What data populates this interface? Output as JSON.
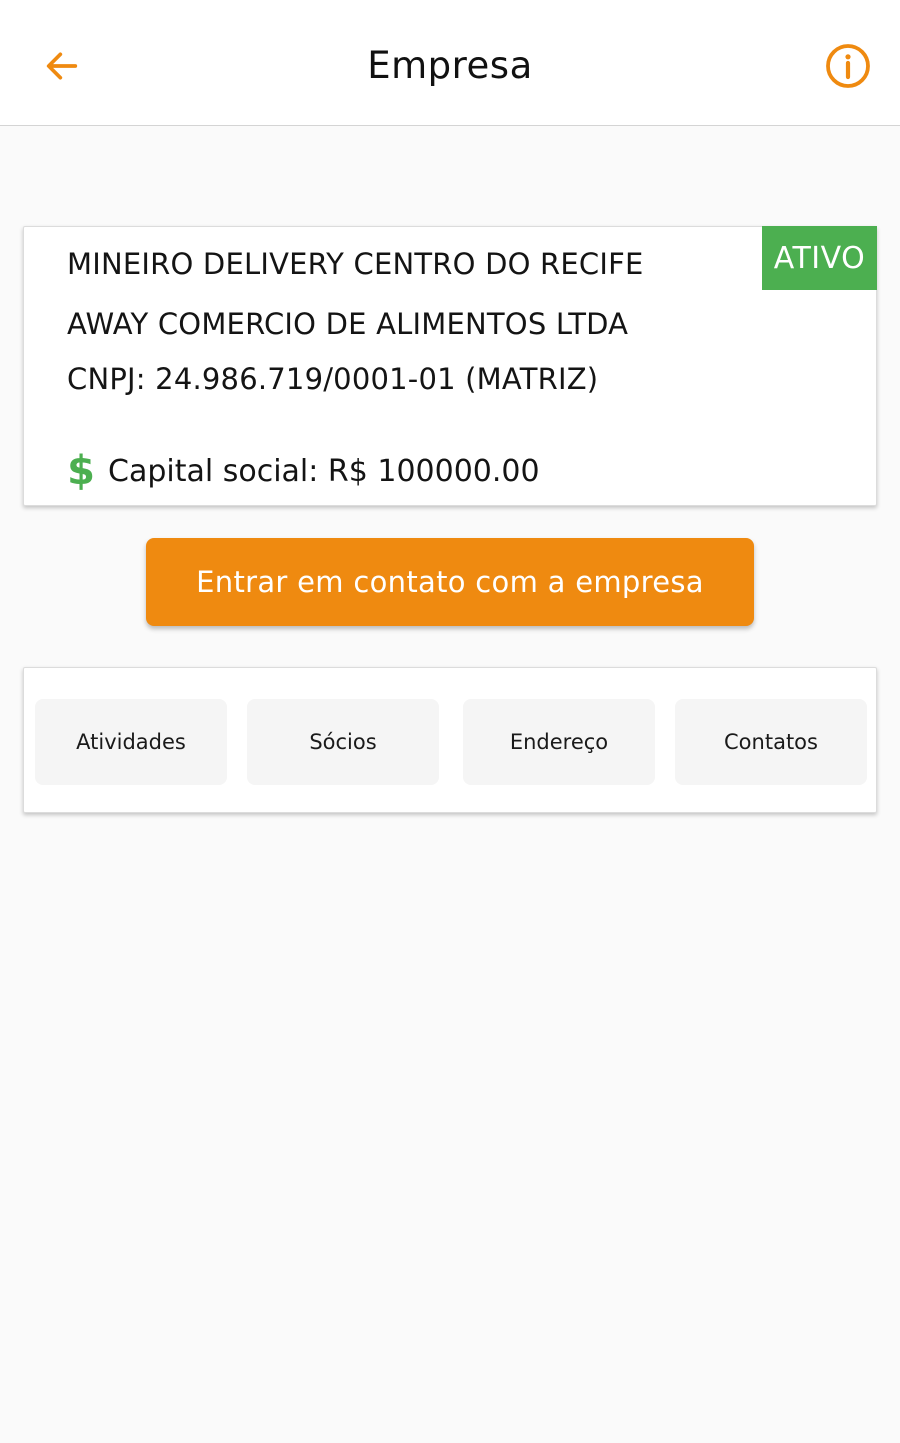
{
  "appbar": {
    "title": "Empresa",
    "back_icon": "arrow-left-icon",
    "info_icon": "info-circle-icon",
    "accent_color": "#ef8a10"
  },
  "company": {
    "status": "ATIVO",
    "status_color": "#4caf50",
    "name": "MINEIRO DELIVERY CENTRO DO RECIFE",
    "razao_social": "AWAY COMERCIO DE ALIMENTOS LTDA",
    "cnpj": "CNPJ: 24.986.719/0001-01 (MATRIZ)",
    "capital_icon": "$",
    "capital": "Capital social: R$ 100000.00"
  },
  "contact_button": {
    "label": "Entrar em contato com a empresa",
    "color": "#ef8a10"
  },
  "tabs": [
    {
      "label": "Atividades"
    },
    {
      "label": "Sócios"
    },
    {
      "label": "Endereço"
    },
    {
      "label": "Contatos"
    }
  ]
}
